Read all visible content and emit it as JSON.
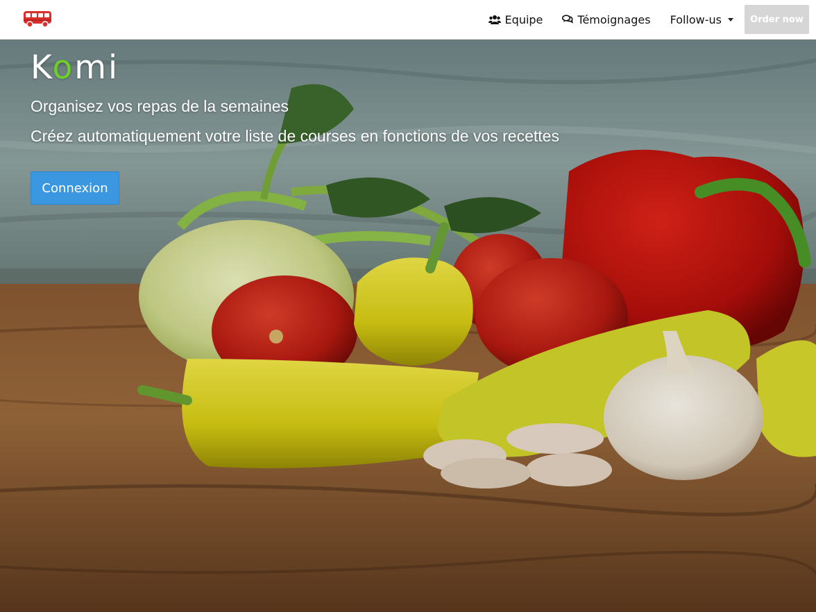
{
  "navbar": {
    "brand_icon": "bus-icon",
    "links": [
      {
        "label": "Equipe",
        "icon": "users-icon"
      },
      {
        "label": "Témoignages",
        "icon": "comments-icon"
      },
      {
        "label": "Follow-us",
        "icon": "chevron-down-icon"
      }
    ],
    "order_label": "Order now"
  },
  "hero": {
    "logo_before": "K",
    "logo_o": "o",
    "logo_after": "mi",
    "tagline1": "Organisez vos repas de la semaines",
    "tagline2": "Créez automatiquement votre liste de courses en fonctions de vos recettes",
    "cta_label": "Connexion"
  },
  "colors": {
    "accent": "#3b97e0",
    "logo_o": "#6fcf2a",
    "brand_red": "#d9302c",
    "order_bg": "#d6d6d6"
  }
}
